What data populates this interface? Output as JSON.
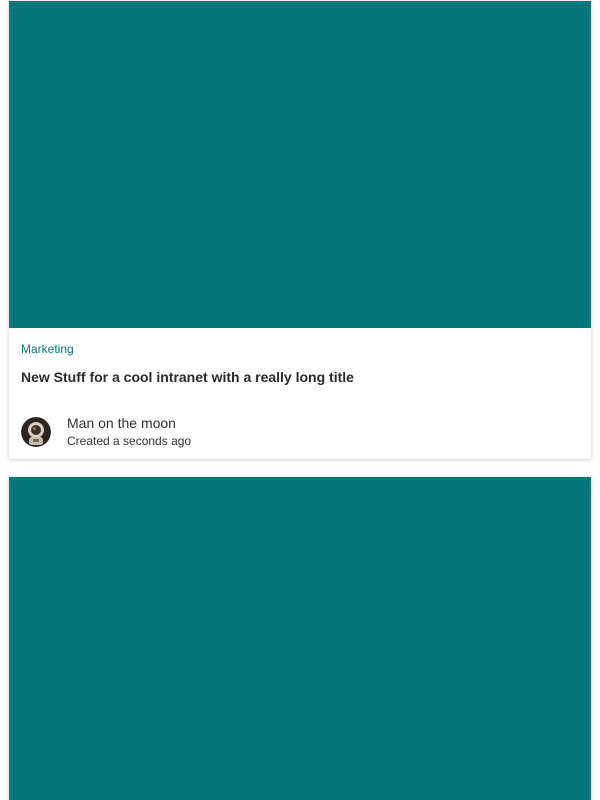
{
  "colors": {
    "image_placeholder": "#05777A",
    "accent": "#05777A"
  },
  "cards": [
    {
      "category": "Marketing",
      "title": "New Stuff for a cool intranet with a really long title",
      "author": "Man on the moon",
      "created": "Created a seconds ago",
      "avatar_icon": "astronaut-avatar"
    },
    {
      "image_only": true
    }
  ]
}
